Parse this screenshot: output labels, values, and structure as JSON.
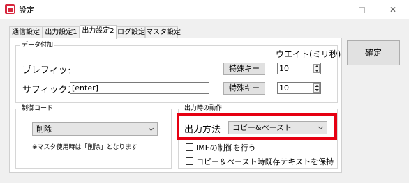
{
  "window": {
    "title": "設定",
    "icon": "app-settings-icon",
    "controls": {
      "minimize": "minimize-icon",
      "maximize": "maximize-icon",
      "close": "✕"
    }
  },
  "tabs": [
    {
      "label": "通信設定",
      "active": false
    },
    {
      "label": "出力設定1",
      "active": false
    },
    {
      "label": "出力設定2",
      "active": true
    },
    {
      "label": "ログ設定",
      "active": false
    },
    {
      "label": "マスタ設定",
      "active": false
    }
  ],
  "data_append": {
    "title": "データ付加",
    "wait_label": "ウエイト(ミリ秒)",
    "prefix": {
      "label": "プレフィックス",
      "value": "",
      "special_button": "特殊キー",
      "wait": "10"
    },
    "suffix": {
      "label": "サフィックス",
      "value": "[enter]",
      "special_button": "特殊キー",
      "wait": "10"
    }
  },
  "control_code": {
    "title": "制御コード",
    "selected": "削除",
    "note": "※マスタ使用時は「削除」となります"
  },
  "output_behavior": {
    "title": "出力時の動作",
    "method_label": "出力方法",
    "method_selected": "コピー&ペースト",
    "ime_checkbox_label": "IMEの制御を行う",
    "ime_checked": false,
    "keep_text_checkbox_label": "コピー＆ペースト時既存テキストを保持",
    "keep_text_checked": false
  },
  "buttons": {
    "confirm": "確定"
  },
  "colors": {
    "highlight": "#e60012",
    "focus": "#0078d7"
  }
}
